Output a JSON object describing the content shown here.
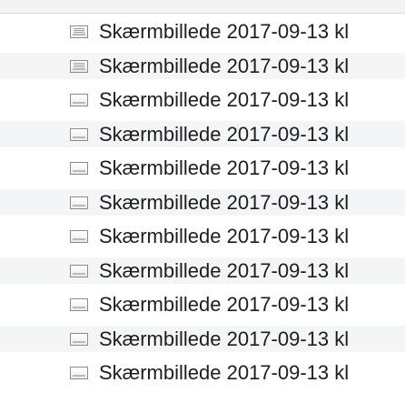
{
  "files": [
    {
      "name": "Skærmbillede 2017-09-13 kl",
      "icon": "screenshot-icon"
    },
    {
      "name": "Skærmbillede 2017-09-13 kl",
      "icon": "document-icon"
    },
    {
      "name": "Skærmbillede 2017-09-13 kl",
      "icon": "screenshot-icon"
    },
    {
      "name": "Skærmbillede 2017-09-13 kl",
      "icon": "screenshot-icon"
    },
    {
      "name": "Skærmbillede 2017-09-13 kl",
      "icon": "screenshot-icon"
    },
    {
      "name": "Skærmbillede 2017-09-13 kl",
      "icon": "screenshot-icon"
    },
    {
      "name": "Skærmbillede 2017-09-13 kl",
      "icon": "screenshot-icon"
    },
    {
      "name": "Skærmbillede 2017-09-13 kl",
      "icon": "screenshot-icon"
    },
    {
      "name": "Skærmbillede 2017-09-13 kl",
      "icon": "screenshot-icon"
    },
    {
      "name": "Skærmbillede 2017-09-13 kl",
      "icon": "screenshot-icon"
    },
    {
      "name": "Skærmbillede 2017-09-13 kl",
      "icon": "screenshot-icon"
    }
  ]
}
